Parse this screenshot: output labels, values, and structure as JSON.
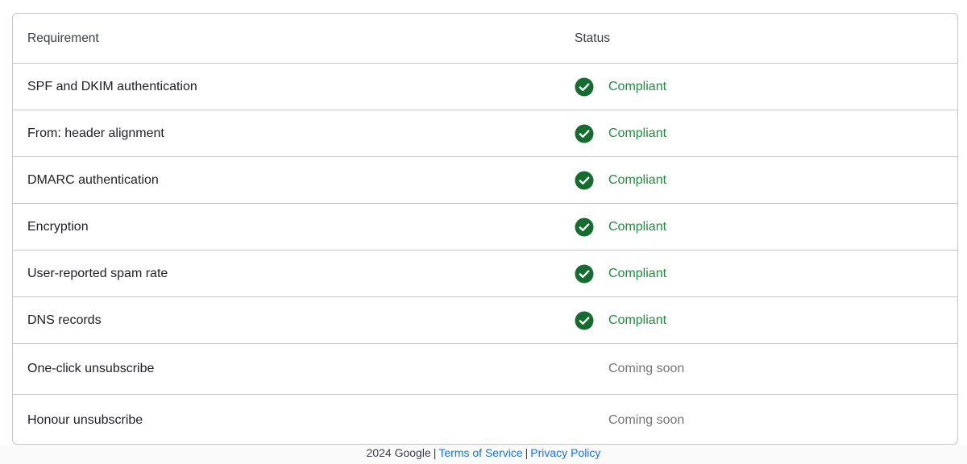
{
  "table": {
    "headers": {
      "requirement": "Requirement",
      "status": "Status"
    },
    "rows": [
      {
        "requirement": "SPF and DKIM authentication",
        "status": "Compliant",
        "state": "compliant"
      },
      {
        "requirement": "From: header alignment",
        "status": "Compliant",
        "state": "compliant"
      },
      {
        "requirement": "DMARC authentication",
        "status": "Compliant",
        "state": "compliant"
      },
      {
        "requirement": "Encryption",
        "status": "Compliant",
        "state": "compliant"
      },
      {
        "requirement": "User-reported spam rate",
        "status": "Compliant",
        "state": "compliant"
      },
      {
        "requirement": "DNS records",
        "status": "Compliant",
        "state": "compliant"
      },
      {
        "requirement": "One-click unsubscribe",
        "status": "Coming soon",
        "state": "coming-soon"
      },
      {
        "requirement": "Honour unsubscribe",
        "status": "Coming soon",
        "state": "coming-soon"
      }
    ]
  },
  "icons": {
    "compliant": "check-circle-icon"
  },
  "colors": {
    "compliant_icon": "#146c2e",
    "compliant_text": "#1e8e3e",
    "coming_soon_text": "#757575",
    "link": "#1a73e8",
    "border": "#c7c7c7"
  },
  "footer": {
    "copyright": "2024 Google",
    "separator": "|",
    "terms_label": "Terms of Service",
    "privacy_label": "Privacy Policy"
  }
}
